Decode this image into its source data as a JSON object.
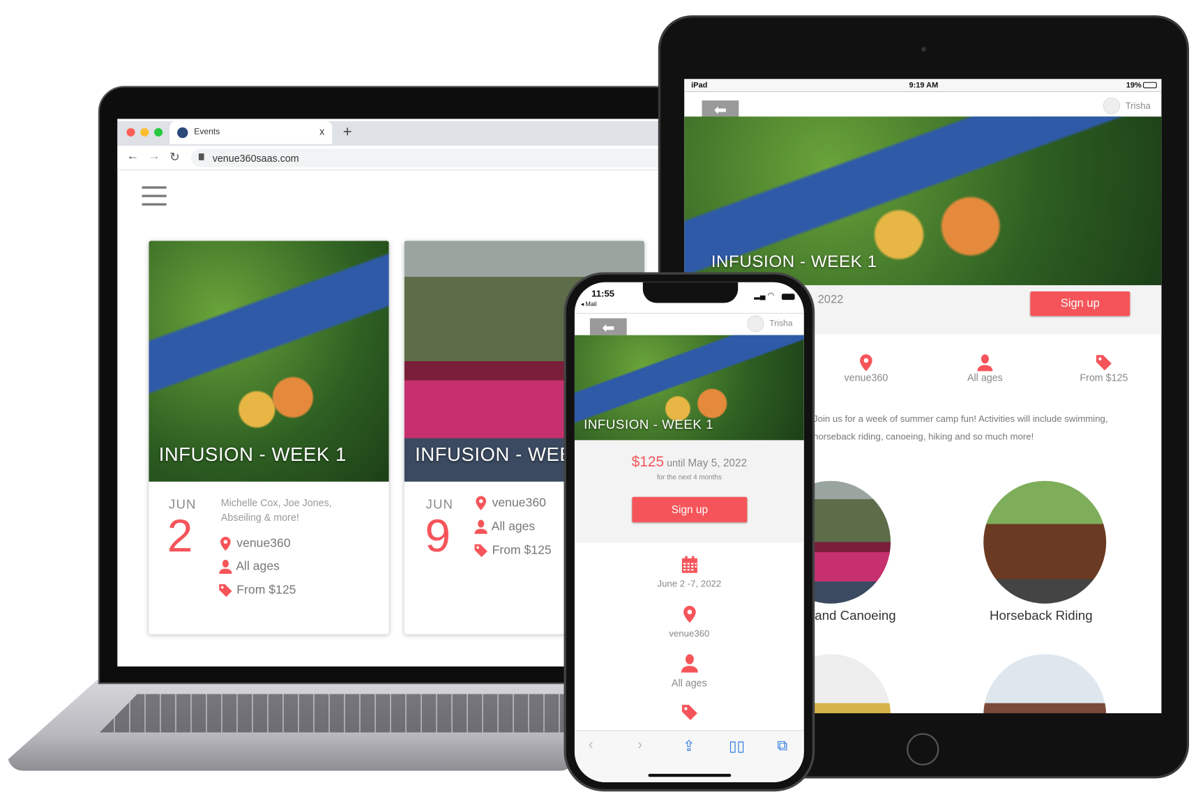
{
  "colors": {
    "accent": "#f5555a",
    "text_grey": "#8a8a8a"
  },
  "laptop": {
    "browser": {
      "tab_title": "Events",
      "url": "venue360saas.com",
      "new_tab": "+",
      "close": "x"
    },
    "menu_icon": "hamburger-icon",
    "cards": [
      {
        "title": "INFUSION - WEEK 1",
        "month": "JUN",
        "day": "2",
        "description": "Michelle Cox, Joe Jones, Abseiling & more!",
        "venue": "venue360",
        "ages": "All ages",
        "price": "From $125"
      },
      {
        "title": "INFUSION - WEE",
        "month": "JUN",
        "day": "9",
        "venue": "venue360",
        "ages": "All ages",
        "price": "From $125"
      }
    ]
  },
  "ipad": {
    "status": {
      "device": "iPad",
      "time": "9:19 AM",
      "battery": "19%"
    },
    "user": "Trisha",
    "hero_title": "INFUSION - WEEK 1",
    "date_fragment": "2022",
    "signup": "Sign up",
    "info": [
      {
        "icon": "map-pin-icon",
        "label": "venue360"
      },
      {
        "icon": "person-icon",
        "label": "All ages"
      },
      {
        "icon": "price-tag-icon",
        "label": "From $125"
      }
    ],
    "description": "Join us for a week of summer camp fun! Activities will include swimming, horseback riding, canoeing, hiking and so much more!",
    "activities": [
      {
        "label": "and Canoeing"
      },
      {
        "label": "Horseback Riding"
      }
    ]
  },
  "phone": {
    "status": {
      "time": "11:55",
      "back_app": "◂ Mail"
    },
    "user": "Trisha",
    "hero_title": "INFUSION - WEEK 1",
    "price": "$125",
    "until": "until",
    "deadline": "May 5, 2022",
    "subnote": "for the next 4 months",
    "signup": "Sign up",
    "details": [
      {
        "icon": "calendar-icon",
        "label": "June 2 -7, 2022"
      },
      {
        "icon": "map-pin-icon",
        "label": "venue360"
      },
      {
        "icon": "person-icon",
        "label": "All ages"
      },
      {
        "icon": "price-tag-icon",
        "label": ""
      }
    ],
    "toolbar": [
      "back-icon",
      "forward-icon",
      "share-icon",
      "bookmarks-icon",
      "tabs-icon"
    ]
  }
}
